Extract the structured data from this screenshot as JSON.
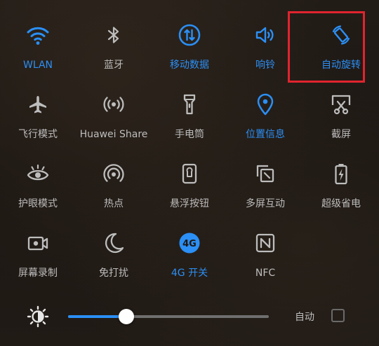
{
  "colors": {
    "active": "#2b8ff5",
    "inactive_icon": "#bdbdbd",
    "inactive_text": "#bdbdbd",
    "highlight_box": "#e0242e",
    "background": "#1c1713"
  },
  "tiles": [
    {
      "label": "WLAN",
      "icon": "wifi-icon",
      "active": true
    },
    {
      "label": "蓝牙",
      "icon": "bluetooth-icon",
      "active": false
    },
    {
      "label": "移动数据",
      "icon": "mobile-data-icon",
      "active": true
    },
    {
      "label": "响铃",
      "icon": "speaker-icon",
      "active": true
    },
    {
      "label": "自动旋转",
      "icon": "auto-rotate-icon",
      "active": true
    },
    {
      "label": "飞行模式",
      "icon": "airplane-icon",
      "active": false
    },
    {
      "label": "Huawei Share",
      "icon": "huawei-share-icon",
      "active": false
    },
    {
      "label": "手电筒",
      "icon": "flashlight-icon",
      "active": false
    },
    {
      "label": "位置信息",
      "icon": "location-icon",
      "active": true
    },
    {
      "label": "截屏",
      "icon": "screenshot-icon",
      "active": false
    },
    {
      "label": "护眼模式",
      "icon": "eye-icon",
      "active": false
    },
    {
      "label": "热点",
      "icon": "hotspot-icon",
      "active": false
    },
    {
      "label": "悬浮按钮",
      "icon": "floating-button-icon",
      "active": false
    },
    {
      "label": "多屏互动",
      "icon": "multi-screen-icon",
      "active": false
    },
    {
      "label": "超级省电",
      "icon": "battery-saver-icon",
      "active": false
    },
    {
      "label": "屏幕录制",
      "icon": "screen-record-icon",
      "active": false
    },
    {
      "label": "免打扰",
      "icon": "moon-icon",
      "active": false
    },
    {
      "label": "4G 开关",
      "icon": "4g-icon",
      "active": true,
      "icon_text": "4G"
    },
    {
      "label": "NFC",
      "icon": "nfc-icon",
      "active": false
    }
  ],
  "brightness": {
    "icon": "brightness-icon",
    "level_fraction": 0.29,
    "auto_label": "自动",
    "auto_checked": false
  }
}
